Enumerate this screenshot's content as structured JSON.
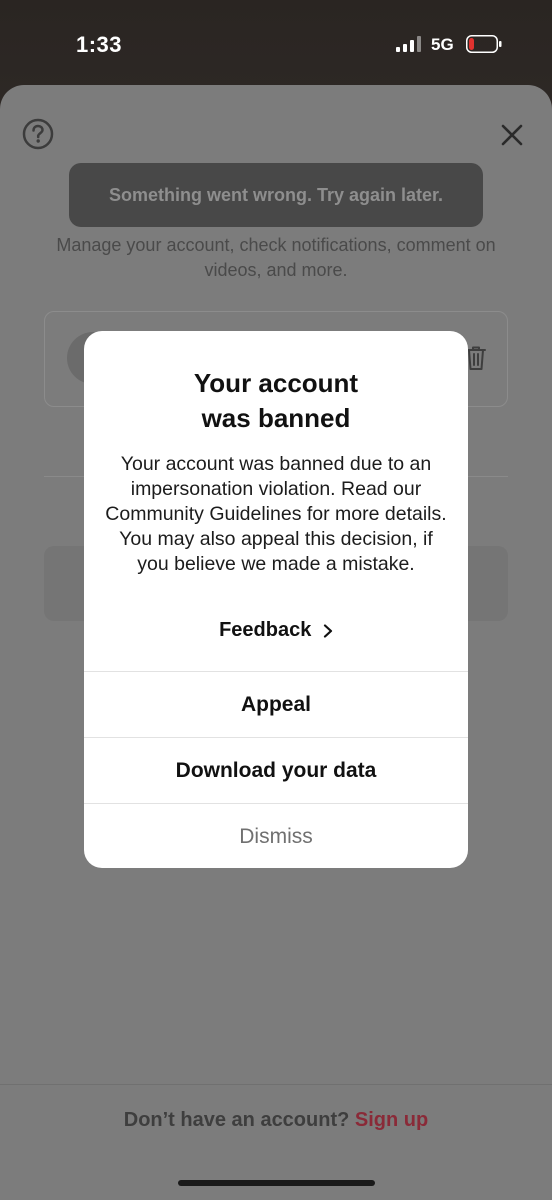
{
  "status_bar": {
    "time": "1:33",
    "network": "5G"
  },
  "page": {
    "toast": "Something went wrong. Try again later.",
    "subtitle": "Manage your account, check notifications, comment on videos, and more.",
    "signup": {
      "prompt": "Don’t have an account?",
      "link": "Sign up"
    }
  },
  "modal": {
    "title": "Your account was banned",
    "body": "Your account was banned due to an impersonation violation. Read our Community Guidelines for more details. You may also appeal this decision, if you believe we made a mistake.",
    "feedback_label": "Feedback",
    "actions": {
      "appeal": "Appeal",
      "download": "Download your data",
      "dismiss": "Dismiss"
    }
  },
  "colors": {
    "signup_accent": "#8a2a38",
    "battery_low": "#e0322f"
  },
  "icons": [
    "help-icon",
    "close-icon",
    "trash-icon",
    "chevron-right-icon",
    "signal-icon",
    "battery-icon"
  ]
}
